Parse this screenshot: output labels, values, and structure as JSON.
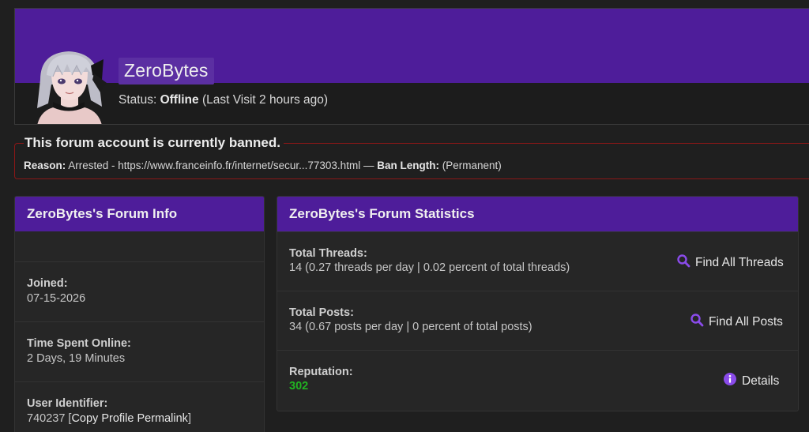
{
  "profile": {
    "username": "ZeroBytes",
    "status_prefix": "Status: ",
    "status_value": "Offline",
    "last_visit": " (Last Visit 2 hours ago)"
  },
  "ban": {
    "title": "This forum account is currently banned.",
    "reason_label": "Reason:",
    "reason_text": " Arrested - https://www.franceinfo.fr/internet/secur...77303.html — ",
    "length_label": "Ban Length:",
    "length_value": " (Permanent)"
  },
  "info_panel": {
    "title": "ZeroBytes's Forum Info",
    "rows": [
      {
        "label": "Joined:",
        "value": "07-15-2026"
      },
      {
        "label": "Time Spent Online:",
        "value": "2 Days, 19 Minutes"
      },
      {
        "label": "User Identifier:",
        "value": "740237",
        "link": "Copy Profile Permalink"
      }
    ]
  },
  "stats_panel": {
    "title": "ZeroBytes's Forum Statistics",
    "threads": {
      "label": "Total Threads:",
      "value": "14 (0.27 threads per day | 0.02 percent of total threads)",
      "action": "Find All Threads"
    },
    "posts": {
      "label": "Total Posts:",
      "value": "34 (0.67 posts per day | 0 percent of total posts)",
      "action": "Find All Posts"
    },
    "reputation": {
      "label": "Reputation:",
      "value": "302",
      "action": "Details"
    }
  },
  "colors": {
    "accent_purple": "#4e1d9a",
    "ban_border": "#8b1717",
    "reputation_green": "#22b322",
    "icon_purple": "#8a4bea"
  },
  "icons": {
    "search": "search-icon",
    "info": "info-icon"
  }
}
